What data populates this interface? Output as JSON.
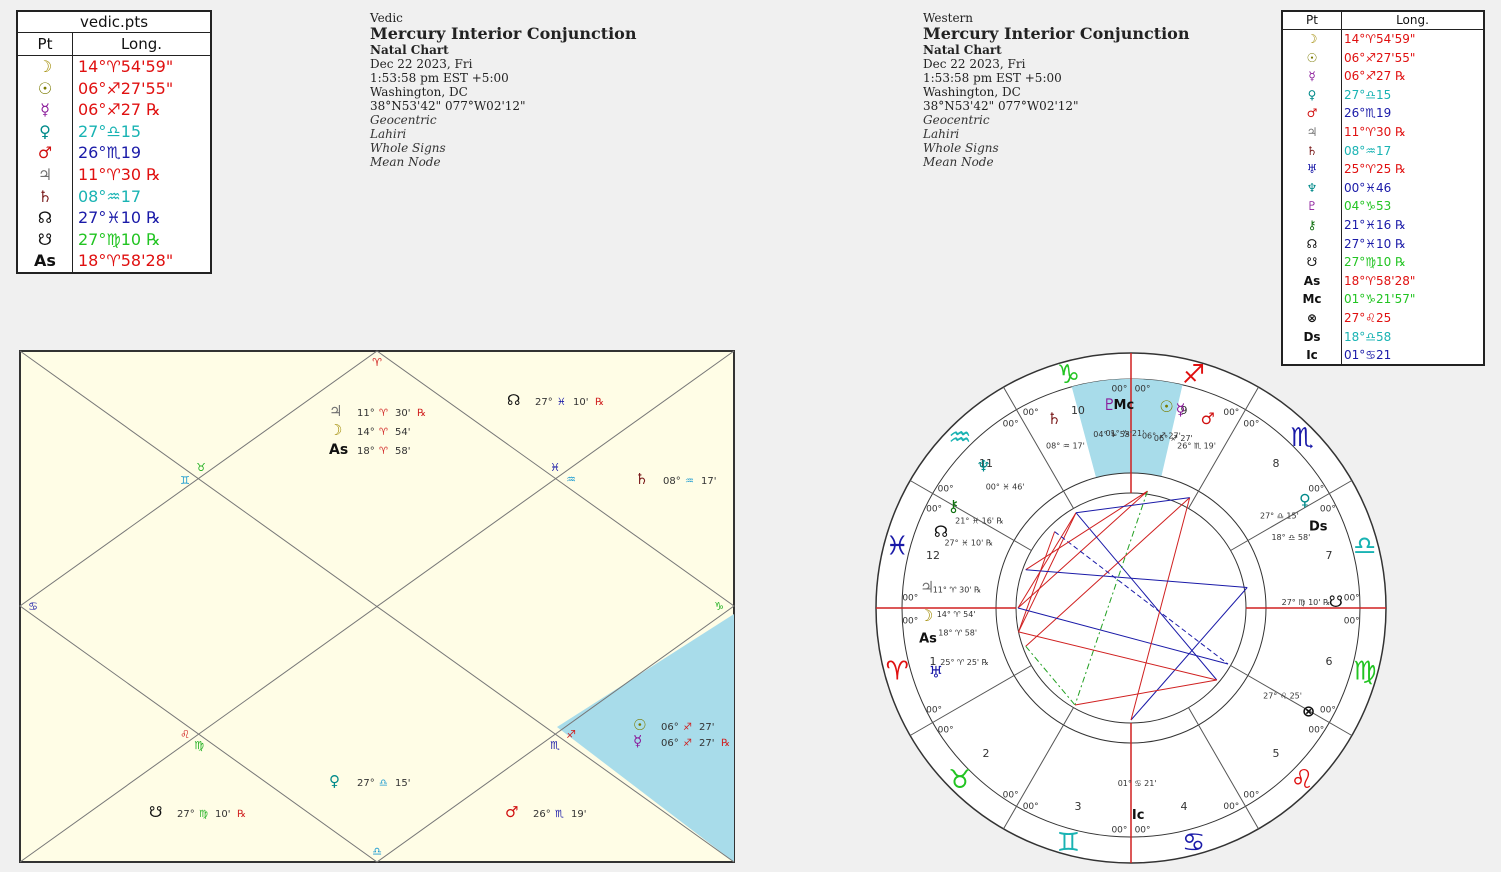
{
  "vedic_table": {
    "title": "vedic.pts",
    "col_pt": "Pt",
    "col_long": "Long.",
    "rows": [
      {
        "glyph": "☽",
        "icon": "moon-icon",
        "value": "14°♈54'59\"",
        "color": "#e01010",
        "gcolor": "#a08a00"
      },
      {
        "glyph": "☉",
        "icon": "sun-icon",
        "value": "06°♐27'55\"",
        "color": "#e01010",
        "gcolor": "#7a7a00"
      },
      {
        "glyph": "☿",
        "icon": "mercury-icon",
        "value": "06°♐27 ℞",
        "color": "#e01010",
        "gcolor": "#8a1a9a"
      },
      {
        "glyph": "♀",
        "icon": "venus-icon",
        "value": "27°♎15",
        "color": "#19b3b3",
        "gcolor": "#008a8a"
      },
      {
        "glyph": "♂",
        "icon": "mars-icon",
        "value": "26°♏19",
        "color": "#1a1aa8",
        "gcolor": "#d01010"
      },
      {
        "glyph": "♃",
        "icon": "jupiter-icon",
        "value": "11°♈30 ℞",
        "color": "#e01010",
        "gcolor": "#707070"
      },
      {
        "glyph": "♄",
        "icon": "saturn-icon",
        "value": "08°♒17",
        "color": "#19b3b3",
        "gcolor": "#7a1a1a"
      },
      {
        "glyph": "☊",
        "icon": "north-node-icon",
        "value": "27°♓10 ℞",
        "color": "#1a1aa8",
        "gcolor": "#111111"
      },
      {
        "glyph": "☋",
        "icon": "south-node-icon",
        "value": "27°♍10 ℞",
        "color": "#22c422",
        "gcolor": "#111111"
      },
      {
        "glyph": "As",
        "icon": "ascendant-icon",
        "value": "18°♈58'28\"",
        "color": "#e01010",
        "gcolor": "#111111"
      }
    ]
  },
  "vedic_info": {
    "label": "Vedic",
    "title": "Mercury Interior Conjunction",
    "chart_type": "Natal Chart",
    "date": "Dec 22 2023, Fri",
    "time": "1:53:58 pm  EST +5:00",
    "place": "Washington, DC",
    "coords": "38°N53'42\" 077°W02'12\"",
    "system": "Geocentric",
    "ayanamsa": "Lahiri",
    "houses": "Whole Signs",
    "node": "Mean Node"
  },
  "western_info": {
    "label": "Western",
    "title": "Mercury Interior Conjunction",
    "chart_type": "Natal Chart",
    "date": "Dec 22 2023, Fri",
    "time": "1:53:58 pm  EST +5:00",
    "place": "Washington, DC",
    "coords": "38°N53'42\" 077°W02'12\"",
    "system": "Geocentric",
    "ayanamsa": "Lahiri",
    "houses": "Whole Signs",
    "node": "Mean Node"
  },
  "western_table": {
    "col_pt": "Pt",
    "col_long": "Long.",
    "rows": [
      {
        "glyph": "☽",
        "icon": "moon-icon",
        "value": "14°♈54'59\"",
        "color": "#e01010",
        "gcolor": "#a08a00"
      },
      {
        "glyph": "☉",
        "icon": "sun-icon",
        "value": "06°♐27'55\"",
        "color": "#e01010",
        "gcolor": "#7a7a00"
      },
      {
        "glyph": "☿",
        "icon": "mercury-icon",
        "value": "06°♐27 ℞",
        "color": "#e01010",
        "gcolor": "#8a1a9a"
      },
      {
        "glyph": "♀",
        "icon": "venus-icon",
        "value": "27°♎15",
        "color": "#19b3b3",
        "gcolor": "#008a8a"
      },
      {
        "glyph": "♂",
        "icon": "mars-icon",
        "value": "26°♏19",
        "color": "#1a1aa8",
        "gcolor": "#d01010"
      },
      {
        "glyph": "♃",
        "icon": "jupiter-icon",
        "value": "11°♈30 ℞",
        "color": "#e01010",
        "gcolor": "#707070"
      },
      {
        "glyph": "♄",
        "icon": "saturn-icon",
        "value": "08°♒17",
        "color": "#19b3b3",
        "gcolor": "#7a1a1a"
      },
      {
        "glyph": "♅",
        "icon": "uranus-icon",
        "value": "25°♈25 ℞",
        "color": "#e01010",
        "gcolor": "#1a1aa8"
      },
      {
        "glyph": "♆",
        "icon": "neptune-icon",
        "value": "00°♓46",
        "color": "#1a1aa8",
        "gcolor": "#008a8a"
      },
      {
        "glyph": "♇",
        "icon": "pluto-icon",
        "value": "04°♑53",
        "color": "#22c422",
        "gcolor": "#8a1a9a"
      },
      {
        "glyph": "⚷",
        "icon": "chiron-icon",
        "value": "21°♓16 ℞",
        "color": "#1a1aa8",
        "gcolor": "#107010"
      },
      {
        "glyph": "☊",
        "icon": "north-node-icon",
        "value": "27°♓10 ℞",
        "color": "#1a1aa8",
        "gcolor": "#111111"
      },
      {
        "glyph": "☋",
        "icon": "south-node-icon",
        "value": "27°♍10 ℞",
        "color": "#22c422",
        "gcolor": "#111111"
      },
      {
        "glyph": "As",
        "icon": "ascendant-icon",
        "value": "18°♈58'28\"",
        "color": "#e01010",
        "gcolor": "#111111"
      },
      {
        "glyph": "Mc",
        "icon": "midheaven-icon",
        "value": "01°♑21'57\"",
        "color": "#22c422",
        "gcolor": "#111111"
      },
      {
        "glyph": "⊗",
        "icon": "part-of-fortune-icon",
        "value": "27°♌25",
        "color": "#e01010",
        "gcolor": "#111111"
      },
      {
        "glyph": "Ds",
        "icon": "descendant-icon",
        "value": "18°♎58",
        "color": "#19b3b3",
        "gcolor": "#111111"
      },
      {
        "glyph": "Ic",
        "icon": "imum-coeli-icon",
        "value": "01°♋21",
        "color": "#1a1aa8",
        "gcolor": "#111111"
      }
    ]
  },
  "vedic_chart": {
    "sign_markers": [
      {
        "g": "♈",
        "color": "#d02020"
      },
      {
        "g": "♉",
        "color": "#22b022"
      },
      {
        "g": "♊",
        "color": "#1a9ad0"
      },
      {
        "g": "♋",
        "color": "#1a1aa8"
      },
      {
        "g": "♌",
        "color": "#d02020"
      },
      {
        "g": "♍",
        "color": "#22b022"
      },
      {
        "g": "♎",
        "color": "#1a9ad0"
      },
      {
        "g": "♏",
        "color": "#1a1aa8"
      },
      {
        "g": "♐",
        "color": "#d02020"
      },
      {
        "g": "♑",
        "color": "#22b022"
      },
      {
        "g": "♒",
        "color": "#1a9ad0"
      },
      {
        "g": "♓",
        "color": "#1a1aa8"
      }
    ],
    "planets": [
      {
        "name": "jupiter",
        "glyph": "♃",
        "gcolor": "#707070",
        "deg": "11°",
        "sign": "♈",
        "scolor": "#d02020",
        "min": "30'",
        "retro": "℞"
      },
      {
        "name": "moon",
        "glyph": "☽",
        "gcolor": "#a08a00",
        "deg": "14°",
        "sign": "♈",
        "scolor": "#d02020",
        "min": "54'",
        "retro": ""
      },
      {
        "name": "ascendant",
        "glyph": "As",
        "gcolor": "#111111",
        "deg": "18°",
        "sign": "♈",
        "scolor": "#d02020",
        "min": "58'",
        "retro": ""
      },
      {
        "name": "north-node",
        "glyph": "☊",
        "gcolor": "#111111",
        "deg": "27°",
        "sign": "♓",
        "scolor": "#1a1aa8",
        "min": "10'",
        "retro": "℞"
      },
      {
        "name": "saturn",
        "glyph": "♄",
        "gcolor": "#7a1a1a",
        "deg": "08°",
        "sign": "♒",
        "scolor": "#1a9ad0",
        "min": "17'",
        "retro": ""
      },
      {
        "name": "sun",
        "glyph": "☉",
        "gcolor": "#7a7a00",
        "deg": "06°",
        "sign": "♐",
        "scolor": "#d02020",
        "min": "27'",
        "retro": ""
      },
      {
        "name": "mercury",
        "glyph": "☿",
        "gcolor": "#8a1a9a",
        "deg": "06°",
        "sign": "♐",
        "scolor": "#d02020",
        "min": "27'",
        "retro": "℞"
      },
      {
        "name": "venus",
        "glyph": "♀",
        "gcolor": "#008a8a",
        "deg": "27°",
        "sign": "♎",
        "scolor": "#1a9ad0",
        "min": "15'",
        "retro": ""
      },
      {
        "name": "mars",
        "glyph": "♂",
        "gcolor": "#d01010",
        "deg": "26°",
        "sign": "♏",
        "scolor": "#1a1aa8",
        "min": "19'",
        "retro": ""
      },
      {
        "name": "south-node",
        "glyph": "☋",
        "gcolor": "#111111",
        "deg": "27°",
        "sign": "♍",
        "scolor": "#22b022",
        "min": "10'",
        "retro": "℞"
      }
    ]
  },
  "western_wheel": {
    "signs": [
      {
        "g": "♐",
        "color": "#e01010"
      },
      {
        "g": "♏",
        "color": "#1a1aa8"
      },
      {
        "g": "♎",
        "color": "#19b3b3"
      },
      {
        "g": "♍",
        "color": "#22c422"
      },
      {
        "g": "♌",
        "color": "#e01010"
      },
      {
        "g": "♋",
        "color": "#1a1aa8"
      },
      {
        "g": "♊",
        "color": "#19b3b3"
      },
      {
        "g": "♉",
        "color": "#22c422"
      },
      {
        "g": "♈",
        "color": "#e01010"
      },
      {
        "g": "♓",
        "color": "#1a1aa8"
      },
      {
        "g": "♒",
        "color": "#19b3b3"
      },
      {
        "g": "♑",
        "color": "#22c422"
      }
    ],
    "house_numbers": [
      "9",
      "8",
      "7",
      "6",
      "5",
      "4",
      "3",
      "2",
      "1",
      "12",
      "11",
      "10"
    ],
    "cusp_label": "00°",
    "points": [
      {
        "name": "pluto",
        "glyph": "♇",
        "gcolor": "#8a1a9a",
        "lbl": "04° ♑ 53'"
      },
      {
        "name": "midheaven",
        "glyph": "Mc",
        "gcolor": "#111111",
        "lbl": "01° ♑ 21'"
      },
      {
        "name": "saturn",
        "glyph": "♄",
        "gcolor": "#7a1a1a",
        "lbl": "08° ♒ 17'"
      },
      {
        "name": "sun",
        "glyph": "☉",
        "gcolor": "#7a7a00",
        "lbl": "06° ♐ 27'"
      },
      {
        "name": "mercury",
        "glyph": "☿",
        "gcolor": "#8a1a9a",
        "lbl": "06° ♐ 27'"
      },
      {
        "name": "mars",
        "glyph": "♂",
        "gcolor": "#d01010",
        "lbl": "26° ♏ 19'"
      },
      {
        "name": "venus",
        "glyph": "♀",
        "gcolor": "#008a8a",
        "lbl": "27° ♎ 15'"
      },
      {
        "name": "descendant",
        "glyph": "Ds",
        "gcolor": "#111111",
        "lbl": "18° ♎ 58'"
      },
      {
        "name": "south-node",
        "glyph": "☋",
        "gcolor": "#111111",
        "lbl": "27° ♍ 10' ℞"
      },
      {
        "name": "part-of-fortune",
        "glyph": "⊗",
        "gcolor": "#111111",
        "lbl": "27° ♌ 25'"
      },
      {
        "name": "imum-coeli",
        "glyph": "Ic",
        "gcolor": "#111111",
        "lbl": "01° ♋ 21'"
      },
      {
        "name": "uranus",
        "glyph": "♅",
        "gcolor": "#1a1aa8",
        "lbl": "25° ♈ 25' ℞"
      },
      {
        "name": "ascendant",
        "glyph": "As",
        "gcolor": "#111111",
        "lbl": "18° ♈ 58'"
      },
      {
        "name": "moon",
        "glyph": "☽",
        "gcolor": "#a08a00",
        "lbl": "14° ♈ 54'"
      },
      {
        "name": "jupiter",
        "glyph": "♃",
        "gcolor": "#707070",
        "lbl": "11° ♈ 30' ℞"
      },
      {
        "name": "north-node",
        "glyph": "☊",
        "gcolor": "#111111",
        "lbl": "27° ♓ 10' ℞"
      },
      {
        "name": "chiron",
        "glyph": "⚷",
        "gcolor": "#107010",
        "lbl": "21° ♓ 16' ℞"
      },
      {
        "name": "neptune",
        "glyph": "♆",
        "gcolor": "#008a8a",
        "lbl": "00° ♓ 46'"
      }
    ]
  }
}
